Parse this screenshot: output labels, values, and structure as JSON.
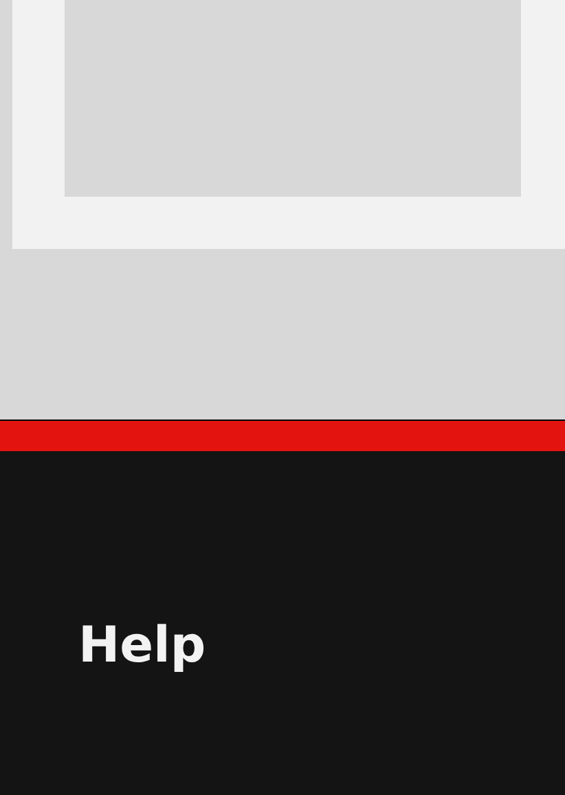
{
  "footer": {
    "heading": "Help"
  }
}
